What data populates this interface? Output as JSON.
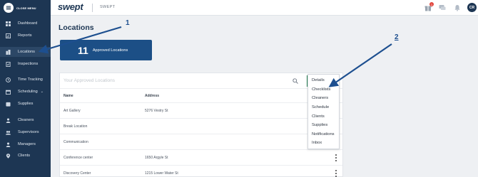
{
  "sidebar": {
    "close_menu_label": "CLOSE MENU",
    "items": [
      {
        "label": "Dashboard",
        "icon": "dashboard-icon"
      },
      {
        "label": "Reports",
        "icon": "reports-icon"
      },
      {
        "label": "Locations",
        "icon": "locations-icon",
        "active": true
      },
      {
        "label": "Inspections",
        "icon": "inspections-icon"
      },
      {
        "label": "Time Tracking",
        "icon": "clock-icon"
      },
      {
        "label": "Scheduling",
        "icon": "calendar-icon",
        "chevron": "⌄"
      },
      {
        "label": "Supplies",
        "icon": "supplies-icon"
      },
      {
        "label": "Cleaners",
        "icon": "person-icon"
      },
      {
        "label": "Supervisors",
        "icon": "group-icon"
      },
      {
        "label": "Managers",
        "icon": "manager-icon"
      },
      {
        "label": "Clients",
        "icon": "pin-icon"
      }
    ]
  },
  "topbar": {
    "logo": "swept",
    "tenant": "SWEPT",
    "notification_count": "1",
    "avatar_initials": "CR"
  },
  "main": {
    "title": "Locations",
    "stat": {
      "value": "11",
      "label": "Approved Locations"
    },
    "search": {
      "placeholder": "Your Approved Locations"
    },
    "table": {
      "headers": [
        "Name",
        "Address"
      ],
      "rows": [
        {
          "name": "Art Gallery",
          "address": "5276 Vestry St"
        },
        {
          "name": "Break Location",
          "address": ""
        },
        {
          "name": "Communication",
          "address": ""
        },
        {
          "name": "Conference center",
          "address": "1650 Argyle St"
        },
        {
          "name": "Discovery Center",
          "address": "1215 Lower Water St"
        }
      ]
    }
  },
  "dropdown": {
    "items": [
      "Details",
      "Checklists",
      "Cleaners",
      "Schedule",
      "Clients",
      "Supplies",
      "Notifications",
      "Inbox"
    ]
  },
  "annotations": {
    "one": "1",
    "two": "2"
  },
  "colors": {
    "sidebar_bg": "#1d3653",
    "card_bg": "#1c4f86",
    "arrow": "#1d4f8f",
    "badge": "#e2463d"
  }
}
